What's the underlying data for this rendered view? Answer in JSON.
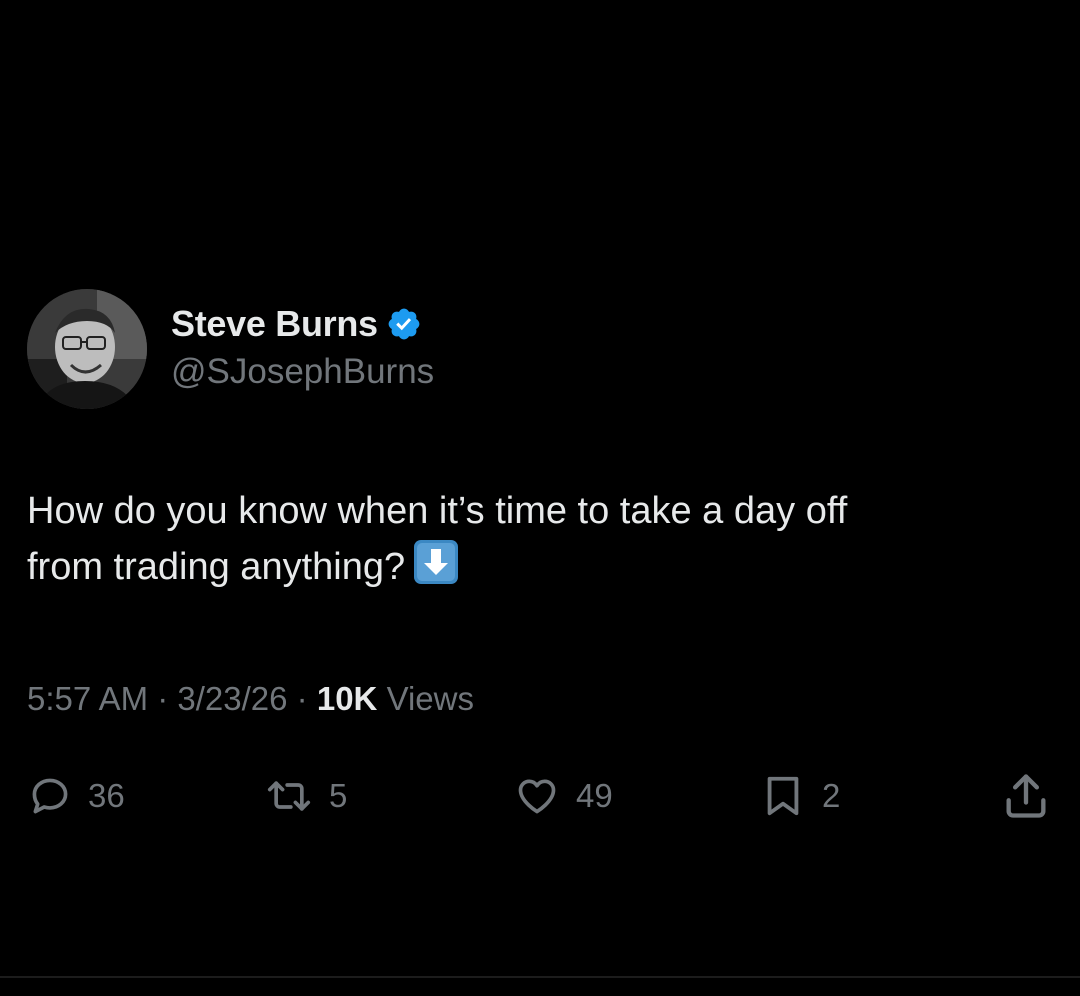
{
  "tweet": {
    "author": {
      "display_name": "Steve Burns",
      "handle": "@SJosephBurns",
      "verified": true,
      "verified_icon": "verified-badge-icon",
      "avatar_icon": "profile-photo"
    },
    "text_line1": "How do you know when it’s time to take a day off",
    "text_line2": "from trading anything?",
    "emoji": "down-arrow-emoji",
    "time": "5:57 AM",
    "date": "3/23/26",
    "separator": " · ",
    "views_count": "10K",
    "views_label": "Views"
  },
  "actions": {
    "reply": {
      "icon": "reply-icon",
      "count": "36"
    },
    "retweet": {
      "icon": "retweet-icon",
      "count": "5"
    },
    "like": {
      "icon": "heart-icon",
      "count": "49"
    },
    "bookmark": {
      "icon": "bookmark-icon",
      "count": "2"
    },
    "share": {
      "icon": "share-icon"
    }
  },
  "colors": {
    "background": "#000000",
    "text_primary": "#e7e9ea",
    "text_secondary": "#71767b",
    "verified_blue": "#1d9bf0",
    "emoji_blue": "#3b88c3"
  }
}
